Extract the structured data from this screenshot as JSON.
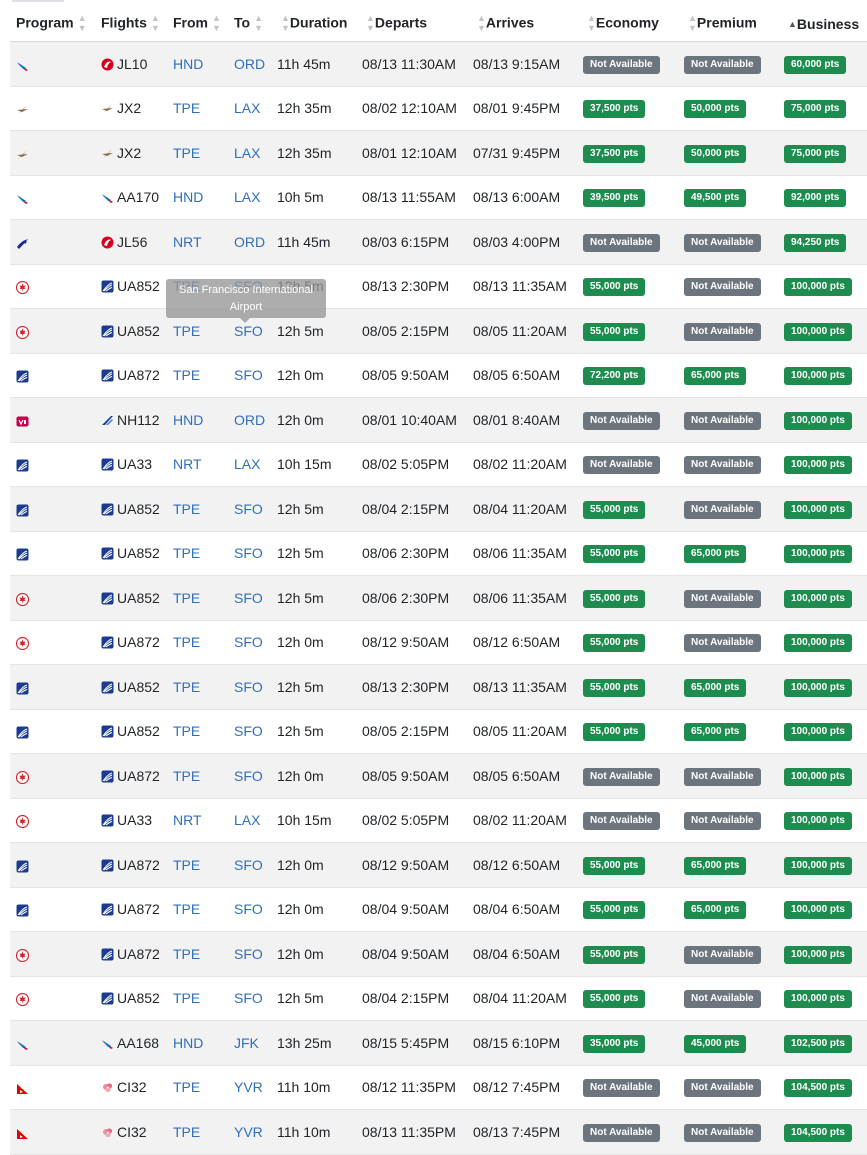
{
  "headers": {
    "program": "Program",
    "flights": "Flights",
    "from": "From",
    "to": "To",
    "duration": "Duration",
    "departs": "Departs",
    "arrives": "Arrives",
    "economy": "Economy",
    "premium": "Premium",
    "business": "Business",
    "sorted_column": "business"
  },
  "tooltip": {
    "text": "San Francisco International Airport"
  },
  "colors": {
    "available": "#1e8c4f",
    "not_available": "#6c757d",
    "link": "#2f6fbd"
  },
  "rows": [
    {
      "program_icon": "american-airlines-icon",
      "airline_icon": "jal-icon",
      "flight": "JL10",
      "from": "HND",
      "to": "ORD",
      "duration": "11h 45m",
      "departs": "08/13 11:30AM",
      "arrives": "08/13 9:15AM",
      "economy": "Not Available",
      "premium": "Not Available",
      "business": "60,000 pts"
    },
    {
      "program_icon": "starlux-icon",
      "airline_icon": "starlux-icon",
      "flight": "JX2",
      "from": "TPE",
      "to": "LAX",
      "duration": "12h 35m",
      "departs": "08/02 12:10AM",
      "arrives": "08/01 9:45PM",
      "economy": "37,500 pts",
      "premium": "50,000 pts",
      "business": "75,000 pts"
    },
    {
      "program_icon": "starlux-icon",
      "airline_icon": "starlux-icon",
      "flight": "JX2",
      "from": "TPE",
      "to": "LAX",
      "duration": "12h 35m",
      "departs": "08/01 12:10AM",
      "arrives": "07/31 9:45PM",
      "economy": "37,500 pts",
      "premium": "50,000 pts",
      "business": "75,000 pts"
    },
    {
      "program_icon": "american-airlines-icon",
      "airline_icon": "american-airlines-icon",
      "flight": "AA170",
      "from": "HND",
      "to": "LAX",
      "duration": "10h 5m",
      "departs": "08/13 11:55AM",
      "arrives": "08/13 6:00AM",
      "economy": "39,500 pts",
      "premium": "49,500 pts",
      "business": "92,000 pts"
    },
    {
      "program_icon": "alaska-airlines-icon",
      "airline_icon": "jal-icon",
      "flight": "JL56",
      "from": "NRT",
      "to": "ORD",
      "duration": "11h 45m",
      "departs": "08/03 6:15PM",
      "arrives": "08/03 4:00PM",
      "economy": "Not Available",
      "premium": "Not Available",
      "business": "94,250 pts"
    },
    {
      "program_icon": "air-canada-icon",
      "airline_icon": "united-icon",
      "flight": "UA852",
      "from": "TPE",
      "to": "SFO",
      "duration": "12h 5m",
      "departs": "08/13 2:30PM",
      "arrives": "08/13 11:35AM",
      "economy": "55,000 pts",
      "premium": "Not Available",
      "business": "100,000 pts"
    },
    {
      "program_icon": "air-canada-icon",
      "airline_icon": "united-icon",
      "flight": "UA852",
      "from": "TPE",
      "to": "SFO",
      "duration": "12h 5m",
      "departs": "08/05 2:15PM",
      "arrives": "08/05 11:20AM",
      "economy": "55,000 pts",
      "premium": "Not Available",
      "business": "100,000 pts"
    },
    {
      "program_icon": "united-icon",
      "airline_icon": "united-icon",
      "flight": "UA872",
      "from": "TPE",
      "to": "SFO",
      "duration": "12h 0m",
      "departs": "08/05 9:50AM",
      "arrives": "08/05 6:50AM",
      "economy": "72,200 pts",
      "premium": "65,000 pts",
      "business": "100,000 pts"
    },
    {
      "program_icon": "virgin-atlantic-icon",
      "airline_icon": "ana-icon",
      "flight": "NH112",
      "from": "HND",
      "to": "ORD",
      "duration": "12h 0m",
      "departs": "08/01 10:40AM",
      "arrives": "08/01 8:40AM",
      "economy": "Not Available",
      "premium": "Not Available",
      "business": "100,000 pts"
    },
    {
      "program_icon": "united-icon",
      "airline_icon": "united-icon",
      "flight": "UA33",
      "from": "NRT",
      "to": "LAX",
      "duration": "10h 15m",
      "departs": "08/02 5:05PM",
      "arrives": "08/02 11:20AM",
      "economy": "Not Available",
      "premium": "Not Available",
      "business": "100,000 pts"
    },
    {
      "program_icon": "united-icon",
      "airline_icon": "united-icon",
      "flight": "UA852",
      "from": "TPE",
      "to": "SFO",
      "duration": "12h 5m",
      "departs": "08/04 2:15PM",
      "arrives": "08/04 11:20AM",
      "economy": "55,000 pts",
      "premium": "Not Available",
      "business": "100,000 pts"
    },
    {
      "program_icon": "united-icon",
      "airline_icon": "united-icon",
      "flight": "UA852",
      "from": "TPE",
      "to": "SFO",
      "duration": "12h 5m",
      "departs": "08/06 2:30PM",
      "arrives": "08/06 11:35AM",
      "economy": "55,000 pts",
      "premium": "65,000 pts",
      "business": "100,000 pts"
    },
    {
      "program_icon": "air-canada-icon",
      "airline_icon": "united-icon",
      "flight": "UA852",
      "from": "TPE",
      "to": "SFO",
      "duration": "12h 5m",
      "departs": "08/06 2:30PM",
      "arrives": "08/06 11:35AM",
      "economy": "55,000 pts",
      "premium": "Not Available",
      "business": "100,000 pts"
    },
    {
      "program_icon": "air-canada-icon",
      "airline_icon": "united-icon",
      "flight": "UA872",
      "from": "TPE",
      "to": "SFO",
      "duration": "12h 0m",
      "departs": "08/12 9:50AM",
      "arrives": "08/12 6:50AM",
      "economy": "55,000 pts",
      "premium": "Not Available",
      "business": "100,000 pts"
    },
    {
      "program_icon": "united-icon",
      "airline_icon": "united-icon",
      "flight": "UA852",
      "from": "TPE",
      "to": "SFO",
      "duration": "12h 5m",
      "departs": "08/13 2:30PM",
      "arrives": "08/13 11:35AM",
      "economy": "55,000 pts",
      "premium": "65,000 pts",
      "business": "100,000 pts"
    },
    {
      "program_icon": "united-icon",
      "airline_icon": "united-icon",
      "flight": "UA852",
      "from": "TPE",
      "to": "SFO",
      "duration": "12h 5m",
      "departs": "08/05 2:15PM",
      "arrives": "08/05 11:20AM",
      "economy": "55,000 pts",
      "premium": "65,000 pts",
      "business": "100,000 pts"
    },
    {
      "program_icon": "air-canada-icon",
      "airline_icon": "united-icon",
      "flight": "UA872",
      "from": "TPE",
      "to": "SFO",
      "duration": "12h 0m",
      "departs": "08/05 9:50AM",
      "arrives": "08/05 6:50AM",
      "economy": "Not Available",
      "premium": "Not Available",
      "business": "100,000 pts"
    },
    {
      "program_icon": "air-canada-icon",
      "airline_icon": "united-icon",
      "flight": "UA33",
      "from": "NRT",
      "to": "LAX",
      "duration": "10h 15m",
      "departs": "08/02 5:05PM",
      "arrives": "08/02 11:20AM",
      "economy": "Not Available",
      "premium": "Not Available",
      "business": "100,000 pts"
    },
    {
      "program_icon": "united-icon",
      "airline_icon": "united-icon",
      "flight": "UA872",
      "from": "TPE",
      "to": "SFO",
      "duration": "12h 0m",
      "departs": "08/12 9:50AM",
      "arrives": "08/12 6:50AM",
      "economy": "55,000 pts",
      "premium": "65,000 pts",
      "business": "100,000 pts"
    },
    {
      "program_icon": "united-icon",
      "airline_icon": "united-icon",
      "flight": "UA872",
      "from": "TPE",
      "to": "SFO",
      "duration": "12h 0m",
      "departs": "08/04 9:50AM",
      "arrives": "08/04 6:50AM",
      "economy": "55,000 pts",
      "premium": "65,000 pts",
      "business": "100,000 pts"
    },
    {
      "program_icon": "air-canada-icon",
      "airline_icon": "united-icon",
      "flight": "UA872",
      "from": "TPE",
      "to": "SFO",
      "duration": "12h 0m",
      "departs": "08/04 9:50AM",
      "arrives": "08/04 6:50AM",
      "economy": "55,000 pts",
      "premium": "Not Available",
      "business": "100,000 pts"
    },
    {
      "program_icon": "air-canada-icon",
      "airline_icon": "united-icon",
      "flight": "UA852",
      "from": "TPE",
      "to": "SFO",
      "duration": "12h 5m",
      "departs": "08/04 2:15PM",
      "arrives": "08/04 11:20AM",
      "economy": "55,000 pts",
      "premium": "Not Available",
      "business": "100,000 pts"
    },
    {
      "program_icon": "american-airlines-icon",
      "airline_icon": "american-airlines-icon",
      "flight": "AA168",
      "from": "HND",
      "to": "JFK",
      "duration": "13h 25m",
      "departs": "08/15 5:45PM",
      "arrives": "08/15 6:10PM",
      "economy": "35,000 pts",
      "premium": "45,000 pts",
      "business": "102,500 pts"
    },
    {
      "program_icon": "qantas-icon",
      "airline_icon": "china-airlines-icon",
      "flight": "CI32",
      "from": "TPE",
      "to": "YVR",
      "duration": "11h 10m",
      "departs": "08/12 11:35PM",
      "arrives": "08/12 7:45PM",
      "economy": "Not Available",
      "premium": "Not Available",
      "business": "104,500 pts"
    },
    {
      "program_icon": "qantas-icon",
      "airline_icon": "china-airlines-icon",
      "flight": "CI32",
      "from": "TPE",
      "to": "YVR",
      "duration": "11h 10m",
      "departs": "08/13 11:35PM",
      "arrives": "08/13 7:45PM",
      "economy": "Not Available",
      "premium": "Not Available",
      "business": "104,500 pts"
    }
  ]
}
